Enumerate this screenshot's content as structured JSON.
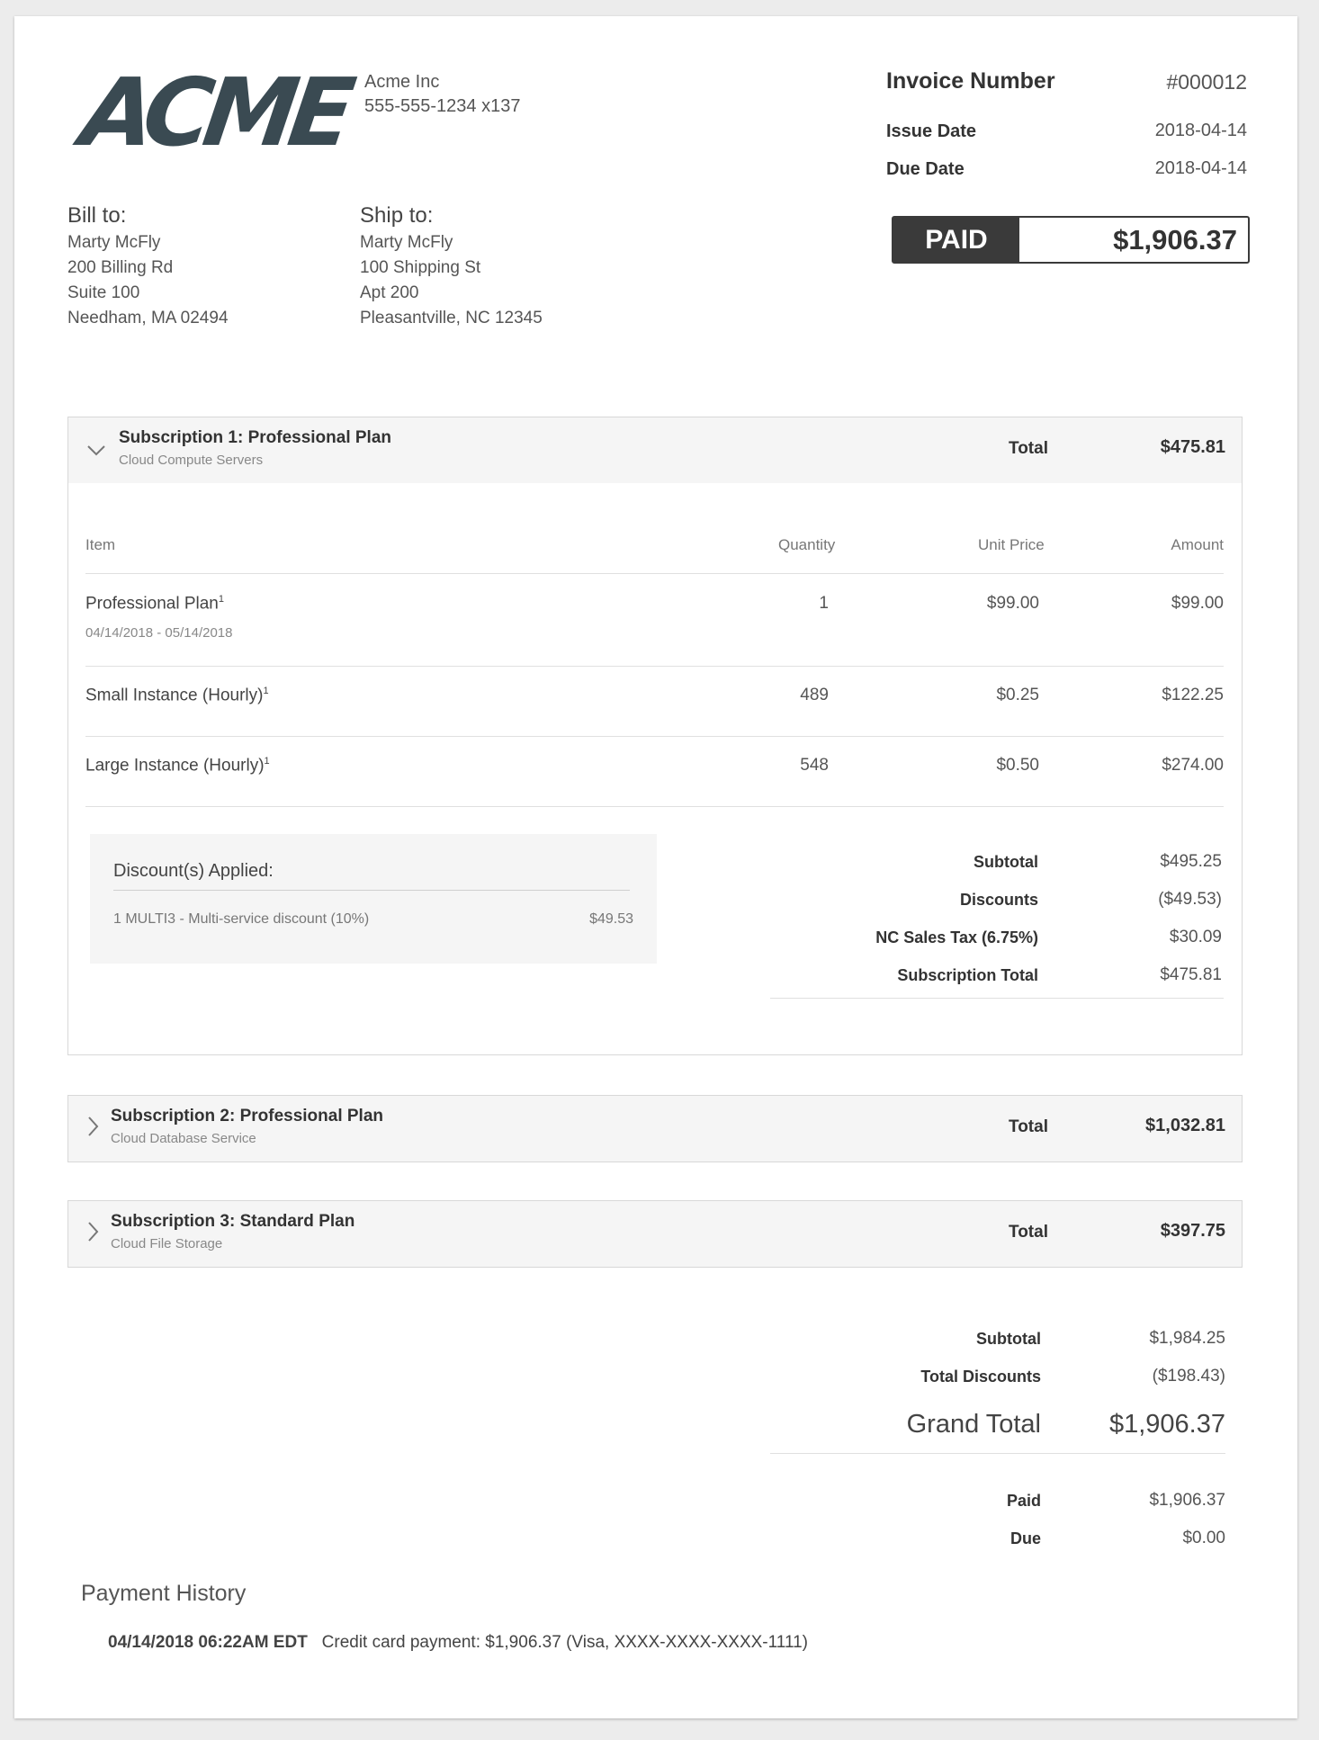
{
  "company": {
    "logo_text": "ACME",
    "name": "Acme Inc",
    "phone": "555-555-1234 x137"
  },
  "invoice": {
    "number_label": "Invoice Number",
    "number": "#000012",
    "issue_label": "Issue Date",
    "issue_date": "2018-04-14",
    "due_label": "Due Date",
    "due_date": "2018-04-14",
    "status": "PAID",
    "status_amount": "$1,906.37"
  },
  "bill_to": {
    "heading": "Bill to:",
    "lines": [
      "Marty McFly",
      "200 Billing Rd",
      "Suite 100",
      "Needham, MA 02494"
    ]
  },
  "ship_to": {
    "heading": "Ship to:",
    "lines": [
      "Marty McFly",
      "100 Shipping St",
      "Apt 200",
      "Pleasantville, NC 12345"
    ]
  },
  "subscriptions": [
    {
      "title": "Subscription 1: Professional Plan",
      "subtitle": "Cloud Compute Servers",
      "total_label": "Total",
      "total": "$475.81",
      "columns": {
        "item": "Item",
        "quantity": "Quantity",
        "unit_price": "Unit Price",
        "amount": "Amount"
      },
      "items": [
        {
          "name": "Professional Plan",
          "note": "1",
          "dates": "04/14/2018 - 05/14/2018",
          "quantity": "1",
          "unit_price": "$99.00",
          "amount": "$99.00"
        },
        {
          "name": "Small Instance (Hourly)",
          "note": "1",
          "quantity": "489",
          "unit_price": "$0.25",
          "amount": "$122.25"
        },
        {
          "name": "Large Instance (Hourly)",
          "note": "1",
          "quantity": "548",
          "unit_price": "$0.50",
          "amount": "$274.00"
        }
      ],
      "discounts_title": "Discount(s) Applied:",
      "discount_line": "1 MULTI3 - Multi-service discount (10%)",
      "discount_amount": "$49.53",
      "summary": [
        {
          "label": "Subtotal",
          "value": "$495.25"
        },
        {
          "label": "Discounts",
          "value": "($49.53)"
        },
        {
          "label": "NC Sales Tax (6.75%)",
          "value": "$30.09"
        },
        {
          "label": "Subscription Total",
          "value": "$475.81"
        }
      ]
    },
    {
      "title": "Subscription 2: Professional Plan",
      "subtitle": "Cloud Database Service",
      "total_label": "Total",
      "total": "$1,032.81"
    },
    {
      "title": "Subscription 3: Standard Plan",
      "subtitle": "Cloud File Storage",
      "total_label": "Total",
      "total": "$397.75"
    }
  ],
  "totals": {
    "subtotal_label": "Subtotal",
    "subtotal": "$1,984.25",
    "discounts_label": "Total Discounts",
    "discounts": "($198.43)",
    "grand_label": "Grand Total",
    "grand": "$1,906.37",
    "paid_label": "Paid",
    "paid": "$1,906.37",
    "due_label": "Due",
    "due": "$0.00"
  },
  "payment_history": {
    "heading": "Payment History",
    "timestamp": "04/14/2018 06:22AM EDT",
    "description": "Credit card payment: $1,906.37 (Visa, XXXX-XXXX-XXXX-1111)"
  }
}
